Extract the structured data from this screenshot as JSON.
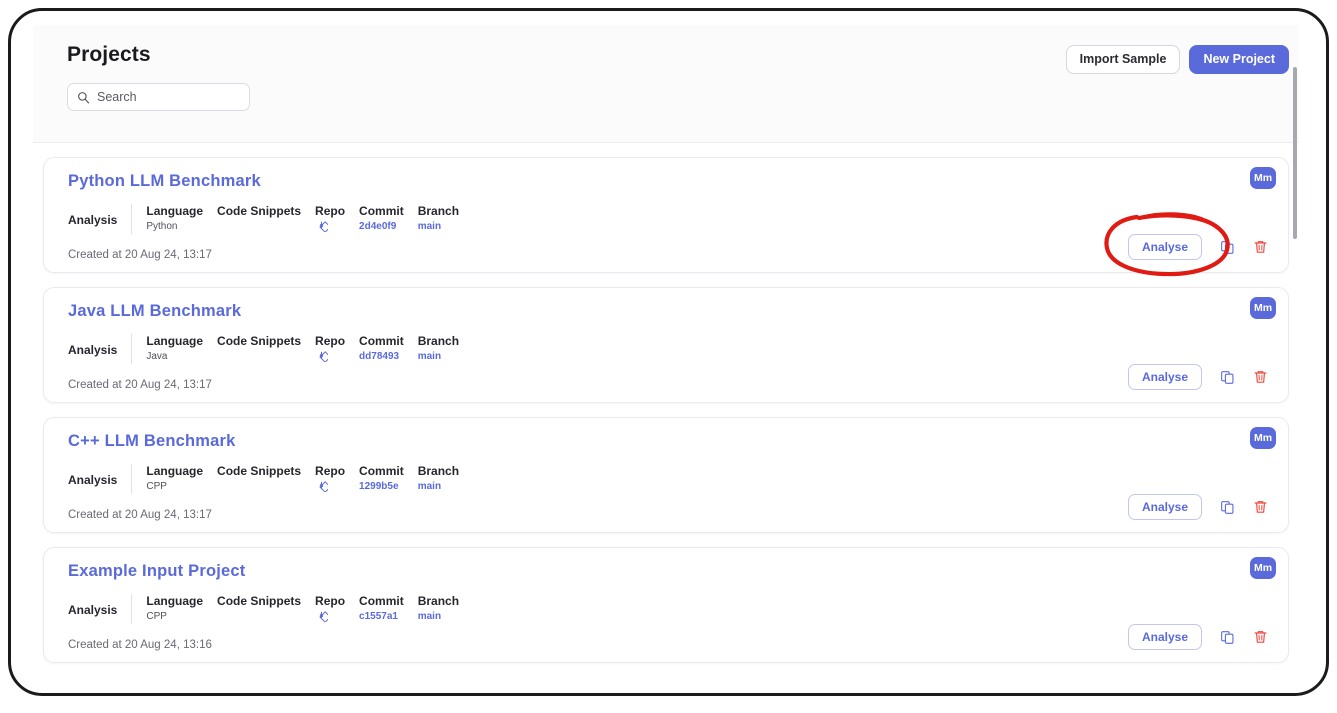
{
  "header": {
    "title": "Projects",
    "import_sample_label": "Import Sample",
    "new_project_label": "New Project"
  },
  "search": {
    "placeholder": "Search",
    "value": "",
    "icon": "search-icon"
  },
  "columns": {
    "analysis": "Analysis",
    "language": "Language",
    "code_snippets": "Code Snippets",
    "repo": "Repo",
    "commit": "Commit",
    "branch": "Branch"
  },
  "actions": {
    "analyse_label": "Analyse",
    "copy_icon": "copy-icon",
    "delete_icon": "trash-icon"
  },
  "colors": {
    "accent": "#5a6ada",
    "danger": "#f0483e",
    "annotation": "#e01b13",
    "text": "#26262e",
    "muted": "#6a6a73"
  },
  "projects": [
    {
      "name": "Python LLM Benchmark",
      "language": "Python",
      "code_snippets": "",
      "repo_icon": "git-repo-icon",
      "commit": "2d4e0f9",
      "branch": "main",
      "created": "Created at 20 Aug 24, 13:17",
      "avatar": "Mm",
      "annotated": true
    },
    {
      "name": "Java LLM Benchmark",
      "language": "Java",
      "code_snippets": "",
      "repo_icon": "git-repo-icon",
      "commit": "dd78493",
      "branch": "main",
      "created": "Created at 20 Aug 24, 13:17",
      "avatar": "Mm",
      "annotated": false
    },
    {
      "name": "C++ LLM Benchmark",
      "language": "CPP",
      "code_snippets": "",
      "repo_icon": "git-repo-icon",
      "commit": "1299b5e",
      "branch": "main",
      "created": "Created at 20 Aug 24, 13:17",
      "avatar": "Mm",
      "annotated": false
    },
    {
      "name": "Example Input Project",
      "language": "CPP",
      "code_snippets": "",
      "repo_icon": "git-repo-icon",
      "commit": "c1557a1",
      "branch": "main",
      "created": "Created at 20 Aug 24, 13:16",
      "avatar": "Mm",
      "annotated": false
    }
  ]
}
